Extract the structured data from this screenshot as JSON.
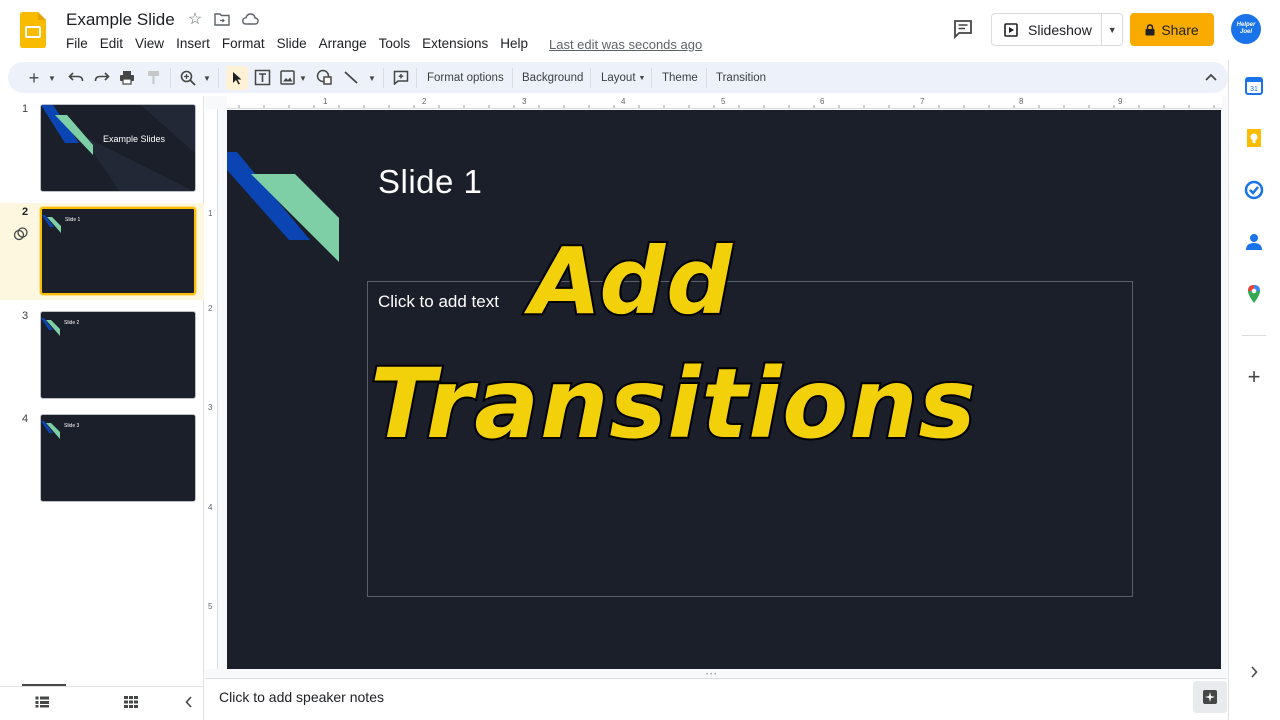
{
  "header": {
    "doc_title": "Example Slide",
    "last_edit": "Last edit was seconds ago",
    "slideshow_label": "Slideshow",
    "share_label": "Share",
    "avatar_text_line1": "Helper",
    "avatar_text_line2": "Joel"
  },
  "menu": [
    "File",
    "Edit",
    "View",
    "Insert",
    "Format",
    "Slide",
    "Arrange",
    "Tools",
    "Extensions",
    "Help"
  ],
  "toolbar": {
    "format_options": "Format options",
    "background": "Background",
    "layout": "Layout",
    "theme": "Theme",
    "transition": "Transition"
  },
  "filmstrip": {
    "slides": [
      {
        "number": "1",
        "title": "Example Slides"
      },
      {
        "number": "2",
        "title": "Slide 1"
      },
      {
        "number": "3",
        "title": "Slide 2"
      },
      {
        "number": "4",
        "title": "Slide 3"
      }
    ],
    "selected_index": 1
  },
  "ruler": {
    "horizontal": [
      "1",
      "2",
      "3",
      "4",
      "5",
      "6",
      "7",
      "8",
      "9"
    ],
    "vertical": [
      "1",
      "2",
      "3",
      "4",
      "5"
    ]
  },
  "slide": {
    "title": "Slide 1",
    "placeholder": "Click to add text"
  },
  "overlay": {
    "line1": "Add",
    "line2": "Transitions"
  },
  "notes": {
    "placeholder": "Click to add speaker notes"
  },
  "colors": {
    "slide_bg": "#1b1f2a",
    "accent_blue": "#0b45b3",
    "accent_green": "#7ecfa5",
    "share_yellow": "#f9ab00",
    "overlay_yellow": "#f2d00a"
  }
}
